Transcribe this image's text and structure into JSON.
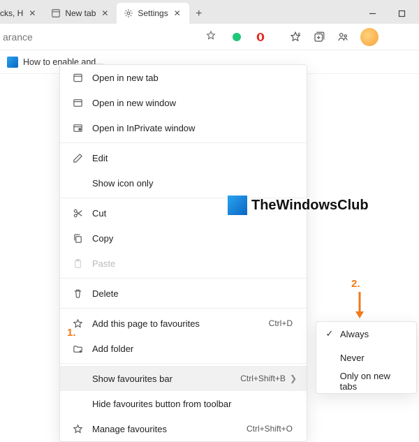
{
  "tabs": {
    "partial_label": "cks, H",
    "tab1_label": "New tab",
    "tab2_label": "Settings"
  },
  "address": {
    "text": "arance"
  },
  "favbar": {
    "item0": "How to enable and..."
  },
  "context_menu": {
    "open_new_tab": "Open in new tab",
    "open_new_window": "Open in new window",
    "open_inprivate": "Open in InPrivate window",
    "edit": "Edit",
    "show_icon_only": "Show icon only",
    "cut": "Cut",
    "copy": "Copy",
    "paste": "Paste",
    "delete": "Delete",
    "add_fav": "Add this page to favourites",
    "add_fav_shortcut": "Ctrl+D",
    "add_folder": "Add folder",
    "show_fav_bar": "Show favourites bar",
    "show_fav_bar_shortcut": "Ctrl+Shift+B",
    "hide_fav_button": "Hide favourites button from toolbar",
    "manage_fav": "Manage favourites",
    "manage_fav_shortcut": "Ctrl+Shift+O"
  },
  "submenu": {
    "always": "Always",
    "never": "Never",
    "only_new_tabs": "Only on new tabs"
  },
  "annotations": {
    "one": "1.",
    "two": "2."
  },
  "watermark": {
    "text": "TheWindowsClub"
  }
}
